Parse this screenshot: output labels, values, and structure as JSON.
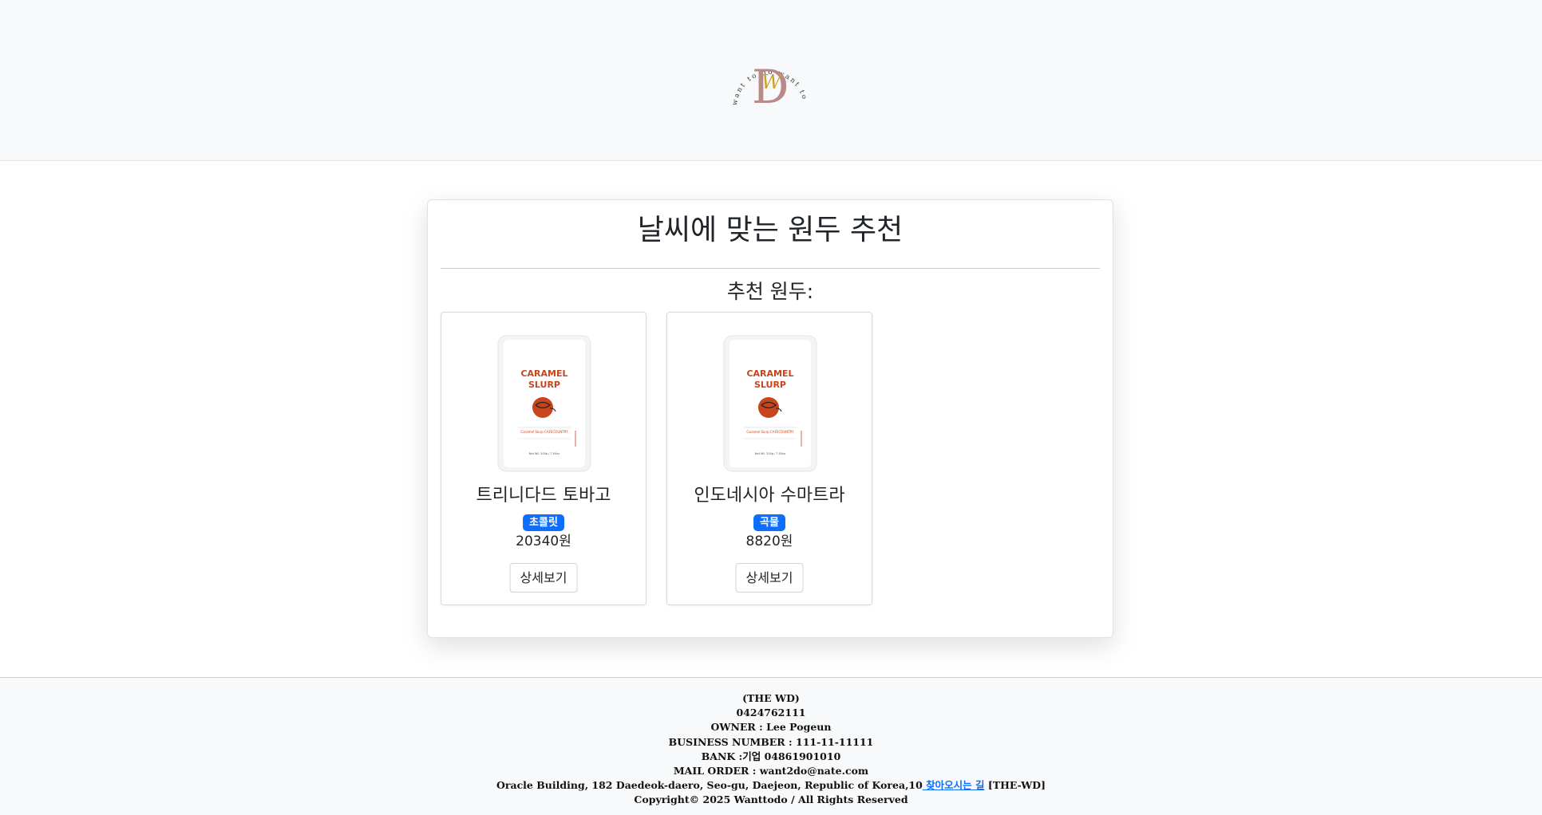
{
  "header": {
    "logo": {
      "ring_text": "want to do want to do want to do",
      "monogram": "DW",
      "colors": {
        "d_letter": "#b98a88",
        "w_letter": "#c9a227",
        "ring_text": "#333333"
      }
    }
  },
  "main": {
    "title": "날씨에 맞는 원두 추천",
    "subtitle": "추천 원두:",
    "products": [
      {
        "image": {
          "line1": "CARAMEL",
          "line2": "SLURP",
          "fine_print": "Caramel Slurp CAFECOUNTRY",
          "bottom_print": "Net Wt. 200g / 7.05oz"
        },
        "name": "트리니다드 토바고",
        "badge": "초콜릿",
        "price": "20340원",
        "button": "상세보기"
      },
      {
        "image": {
          "line1": "CARAMEL",
          "line2": "SLURP",
          "fine_print": "Caramel Slurp CAFECOUNTRY",
          "bottom_print": "Net Wt. 200g / 7.05oz"
        },
        "name": "인도네시아 수마트라",
        "badge": "곡물",
        "price": "8820원",
        "button": "상세보기"
      }
    ]
  },
  "footer": {
    "company": "(THE WD)",
    "phone": "0424762111",
    "owner": "OWNER : Lee Pogeun",
    "business_number": "BUSINESS NUMBER : 111-11-11111",
    "bank": "BANK :기업 04861901010",
    "mail_order": "MAIL ORDER : want2do@nate.com",
    "address": "Oracle Building, 182 Daedeok-daero, Seo-gu, Daejeon, Republic of Korea,10",
    "directions_link": " 찾아오시는 길",
    "address_suffix": " [THE-WD]",
    "copyright": "Copyright© 2025 Wanttodo / All Rights Reserved"
  },
  "colors": {
    "badge": "#0d6efd",
    "link": "#0d6efd",
    "header_bg": "#f8f9fa",
    "package_label": "#c8451c"
  }
}
